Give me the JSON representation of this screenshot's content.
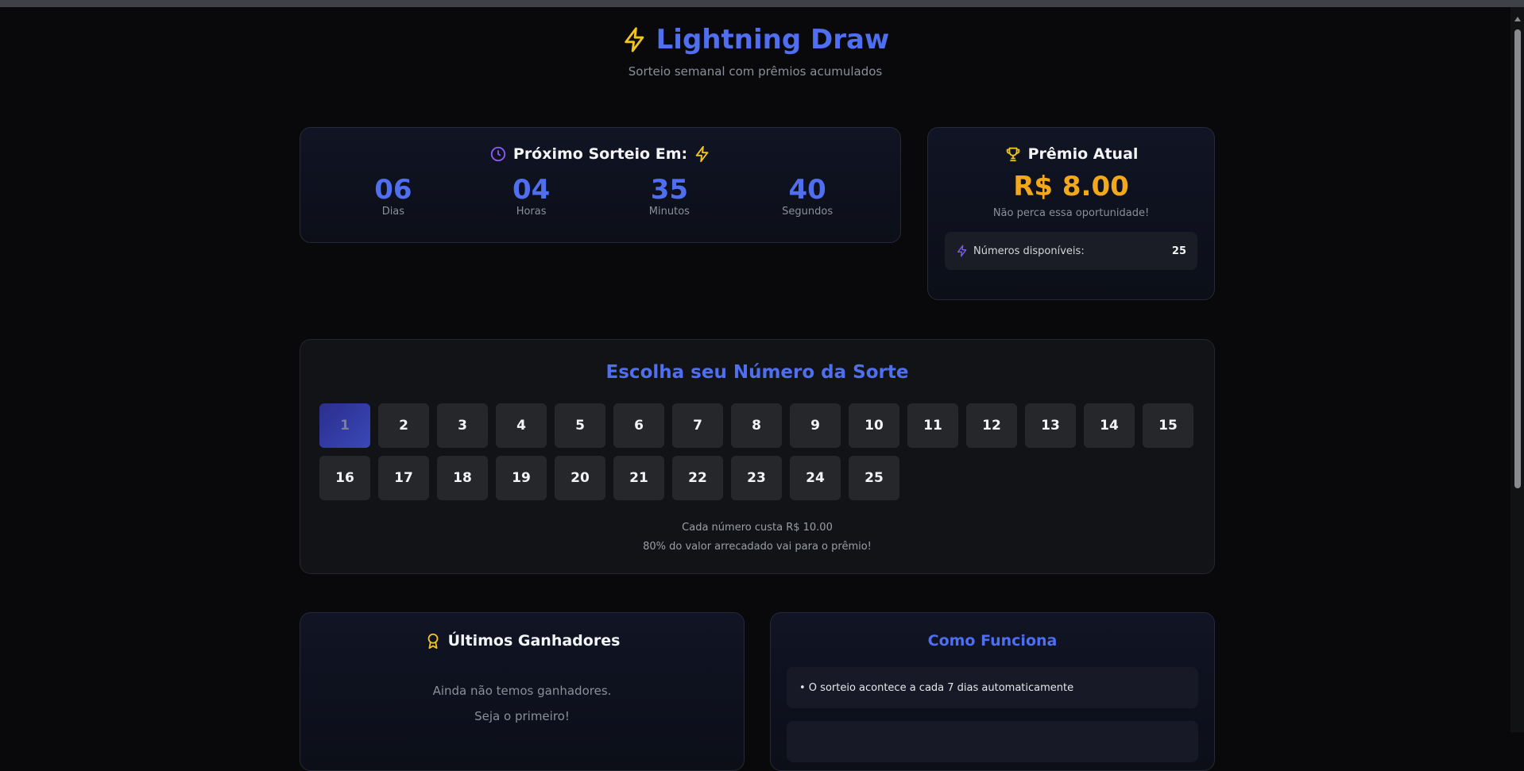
{
  "header": {
    "title": "Lightning Draw",
    "subtitle": "Sorteio semanal com prêmios acumulados"
  },
  "countdown": {
    "title": "Próximo Sorteio Em:",
    "units": [
      {
        "value": "06",
        "label": "Dias"
      },
      {
        "value": "04",
        "label": "Horas"
      },
      {
        "value": "35",
        "label": "Minutos"
      },
      {
        "value": "40",
        "label": "Segundos"
      }
    ]
  },
  "prize": {
    "title": "Prêmio Atual",
    "value": "R$ 8.00",
    "note": "Não perca essa oportunidade!",
    "available_label": "Números disponíveis:",
    "available_count": "25"
  },
  "picker": {
    "title": "Escolha seu Número da Sorte",
    "numbers": [
      "1",
      "2",
      "3",
      "4",
      "5",
      "6",
      "7",
      "8",
      "9",
      "10",
      "11",
      "12",
      "13",
      "14",
      "15",
      "16",
      "17",
      "18",
      "19",
      "20",
      "21",
      "22",
      "23",
      "24",
      "25"
    ],
    "selected": "1",
    "info_cost": "Cada número custa R$ 10.00",
    "info_split": "80% do valor arrecadado vai para o prêmio!"
  },
  "winners": {
    "title": "Últimos Ganhadores",
    "empty_line1": "Ainda não temos ganhadores.",
    "empty_line2": "Seja o primeiro!"
  },
  "how": {
    "title": "Como Funciona",
    "items": [
      "• O sorteio acontece a cada 7 dias automaticamente",
      ""
    ]
  },
  "colors": {
    "accent": "#4f6ef0",
    "gold": "#f2a81d",
    "background": "#09090b"
  }
}
